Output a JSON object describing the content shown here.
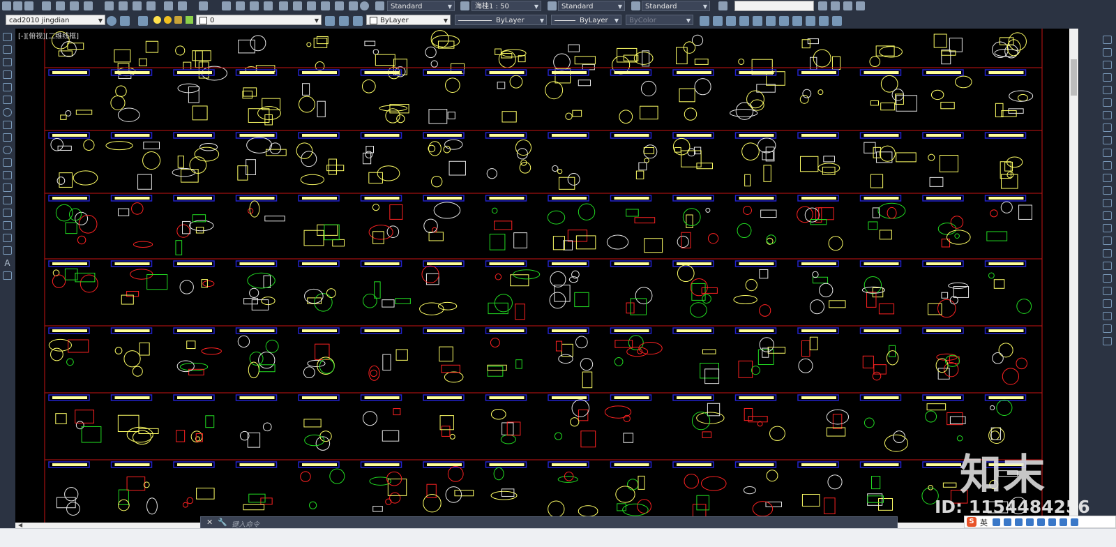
{
  "toolbar_top": {
    "text_style": "Standard",
    "annotation_scale": "海桂1 : 50",
    "table_style": "Standard",
    "multileader_style": "Standard"
  },
  "toolbar_layers": {
    "workspace": "cad2010 jingdian",
    "layer": "0",
    "color": "ByLayer",
    "linetype": "ByLayer",
    "lineweight": "ByLayer",
    "plot_style": "ByColor"
  },
  "viewport": {
    "label": "[-][俯视][二维线框]"
  },
  "command_line": {
    "placeholder": "键入命令"
  },
  "watermark": {
    "logo": "知末",
    "id_text": "ID: 1154484256"
  },
  "ime_bar": {
    "lang": "英"
  },
  "colors": {
    "background": "#000000",
    "ui_panel": "#2b3342",
    "block_yellow": "#ffff66",
    "block_red": "#ff2222",
    "block_green": "#22dd22",
    "block_white": "#e8e8e8",
    "frame_red": "#c81414",
    "title_blue": "#2222cc"
  }
}
